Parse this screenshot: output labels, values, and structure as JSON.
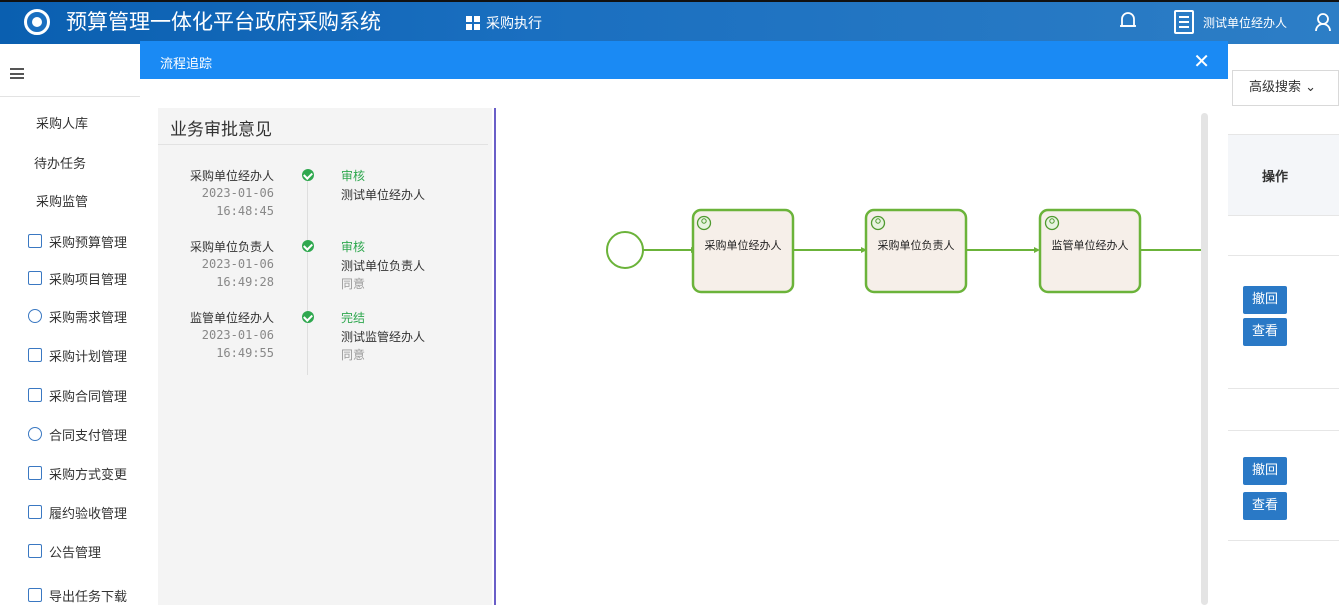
{
  "header": {
    "app_title": "预算管理一体化平台政府采购系统",
    "menu_label": "采购执行",
    "user_name": "测试单位经办人"
  },
  "sidebar": {
    "items": [
      {
        "label": "采购人库",
        "icon": null
      },
      {
        "label": "待办任务",
        "icon": null
      },
      {
        "label": "采购监管",
        "icon": null
      },
      {
        "label": "采购预算管理",
        "icon": "budget-icon"
      },
      {
        "label": "采购项目管理",
        "icon": "project-icon"
      },
      {
        "label": "采购需求管理",
        "icon": "demand-icon"
      },
      {
        "label": "采购计划管理",
        "icon": "plan-icon"
      },
      {
        "label": "采购合同管理",
        "icon": "contract-icon"
      },
      {
        "label": "合同支付管理",
        "icon": "payment-icon"
      },
      {
        "label": "采购方式变更",
        "icon": "method-change-icon"
      },
      {
        "label": "履约验收管理",
        "icon": "acceptance-icon"
      },
      {
        "label": "公告管理",
        "icon": "notice-icon"
      },
      {
        "label": "导出任务下载",
        "icon": "export-icon"
      }
    ]
  },
  "right_panel": {
    "advanced_search": "高级搜索",
    "operation_header": "操作",
    "row1_withdraw": "撤回",
    "row1_view": "查看",
    "row2_withdraw": "撤回",
    "row2_view": "查看"
  },
  "modal": {
    "title": "流程追踪",
    "close_symbol": "✕",
    "approval_title": "业务审批意见",
    "entries": [
      {
        "role": "采购单位经办人",
        "date": "2023-01-06",
        "time": "16:48:45",
        "action": "审核",
        "person": "测试单位经办人",
        "comment": ""
      },
      {
        "role": "采购单位负责人",
        "date": "2023-01-06",
        "time": "16:49:28",
        "action": "审核",
        "person": "测试单位负责人",
        "comment": "同意"
      },
      {
        "role": "监管单位经办人",
        "date": "2023-01-06",
        "time": "16:49:55",
        "action": "完结",
        "person": "测试监管经办人",
        "comment": "同意"
      }
    ],
    "flow_nodes": [
      "采购单位经办人",
      "采购单位负责人",
      "监管单位经办人"
    ],
    "colors": {
      "node_border": "#6bb33a",
      "node_fill": "#f6efe9",
      "accent": "#1a8af4",
      "done": "#2fa84f"
    }
  }
}
